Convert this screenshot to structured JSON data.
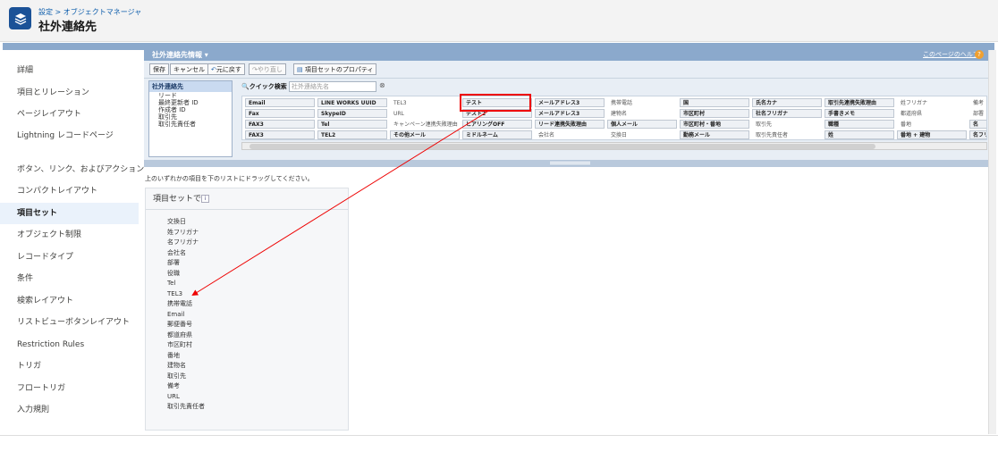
{
  "header": {
    "breadcrumb_setup": "設定",
    "breadcrumb_sep": " > ",
    "breadcrumb_om": "オブジェクトマネージャ",
    "title": "社外連絡先"
  },
  "sidebar": {
    "items": [
      {
        "label": "詳細"
      },
      {
        "label": "項目とリレーション"
      },
      {
        "label": "ページレイアウト"
      },
      {
        "label": "Lightning レコードページ"
      },
      {
        "label": "ボタン、リンク、およびアクション"
      },
      {
        "label": "コンパクトレイアウト"
      },
      {
        "label": "項目セット",
        "active": true
      },
      {
        "label": "オブジェクト制限"
      },
      {
        "label": "レコードタイプ"
      },
      {
        "label": "条件"
      },
      {
        "label": "検索レイアウト"
      },
      {
        "label": "リストビューボタンレイアウト"
      },
      {
        "label": "Restriction Rules"
      },
      {
        "label": "トリガ"
      },
      {
        "label": "フロートリガ"
      },
      {
        "label": "入力規則"
      }
    ]
  },
  "editor": {
    "panel_title": "社外連絡先情報 ▾",
    "help_link": "このページのヘルプ",
    "help_icon": "?",
    "toolbar": {
      "save": "保存",
      "cancel": "キャンセル",
      "undo": "元に戻す",
      "redo": "やり直し",
      "properties": "項目セットのプロパティ"
    },
    "tree": {
      "root": "社外連絡先",
      "items": [
        "リード",
        "最終更新者 ID",
        "作成者 ID",
        "取引先",
        "取引先責任者"
      ]
    },
    "quick_search_label": "クイック検索",
    "quick_search_placeholder": "社外連絡先名",
    "quick_search_clear": "⊗",
    "grid": [
      [
        "Email",
        "LINE WORKS UUID",
        "TEL3",
        "テスト",
        "メールアドレス3",
        "携帯電話",
        "国",
        "氏名カナ",
        "取引先連携失敗理由",
        "姓フリガナ",
        "備考"
      ],
      [
        "Fax",
        "SkypeID",
        "URL",
        "テスト2",
        "メールアドレス3",
        "建物名",
        "市区町村",
        "社名フリガナ",
        "手書きメモ",
        "都道府県",
        "部署"
      ],
      [
        "FAX3",
        "Tel",
        "キャンペーン連携失敗理由",
        "ヒアリングOFF",
        "リード連携失敗理由",
        "個人メール",
        "市区町村・番地",
        "取引先",
        "職種",
        "番地",
        "名"
      ],
      [
        "FAX3",
        "TEL2",
        "その他メール",
        "ミドルネーム",
        "会社名",
        "交換日",
        "勤務メール",
        "取引先責任者",
        "姓",
        "番地 + 建物",
        "名フリガ"
      ]
    ],
    "used_cells": [
      [
        0,
        2
      ],
      [
        1,
        2
      ],
      [
        0,
        5
      ],
      [
        1,
        5
      ],
      [
        2,
        7
      ],
      [
        3,
        4
      ],
      [
        3,
        5
      ],
      [
        3,
        7
      ],
      [
        0,
        9
      ],
      [
        1,
        9
      ],
      [
        1,
        10
      ],
      [
        2,
        9
      ],
      [
        0,
        10
      ],
      [
        2,
        2
      ]
    ],
    "instruction": "上のいずれかの項目を下のリストにドラッグしてください。",
    "section_title": "項目セットで",
    "section_info": "i",
    "section_fields": [
      "交換日",
      "姓フリガナ",
      "名フリガナ",
      "会社名",
      "部署",
      "役職",
      "Tel",
      "TEL3",
      "携帯電話",
      "Email",
      "郵便番号",
      "都道府県",
      "市区町村",
      "番地",
      "建物名",
      "取引先",
      "備考",
      "URL",
      "取引先責任者"
    ]
  },
  "colors": {
    "accent": "#1b5297",
    "panel_blue": "#8ba9cc",
    "highlight_red": "#ee0000"
  }
}
